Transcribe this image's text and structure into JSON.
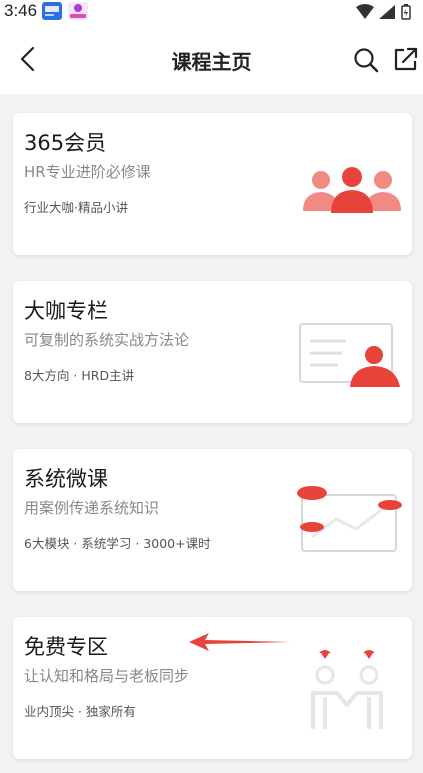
{
  "status_bar": {
    "time": "3:46"
  },
  "header": {
    "title": "课程主页"
  },
  "cards": [
    {
      "title": "365会员",
      "subtitle": "HR专业进阶必修课",
      "tags": "行业大咖·精品小讲"
    },
    {
      "title": "大咖专栏",
      "subtitle": "可复制的系统实战方法论",
      "tags": "8大方向 · HRD主讲"
    },
    {
      "title": "系统微课",
      "subtitle": "用案例传递系统知识",
      "tags": "6大模块 · 系统学习 · 3000+课时"
    },
    {
      "title": "免费专区",
      "subtitle": "让认知和格局与老板同步",
      "tags": "业内顶尖 · 独家所有"
    }
  ],
  "colors": {
    "accent": "#e8433a",
    "line": "#d8d8d8"
  }
}
